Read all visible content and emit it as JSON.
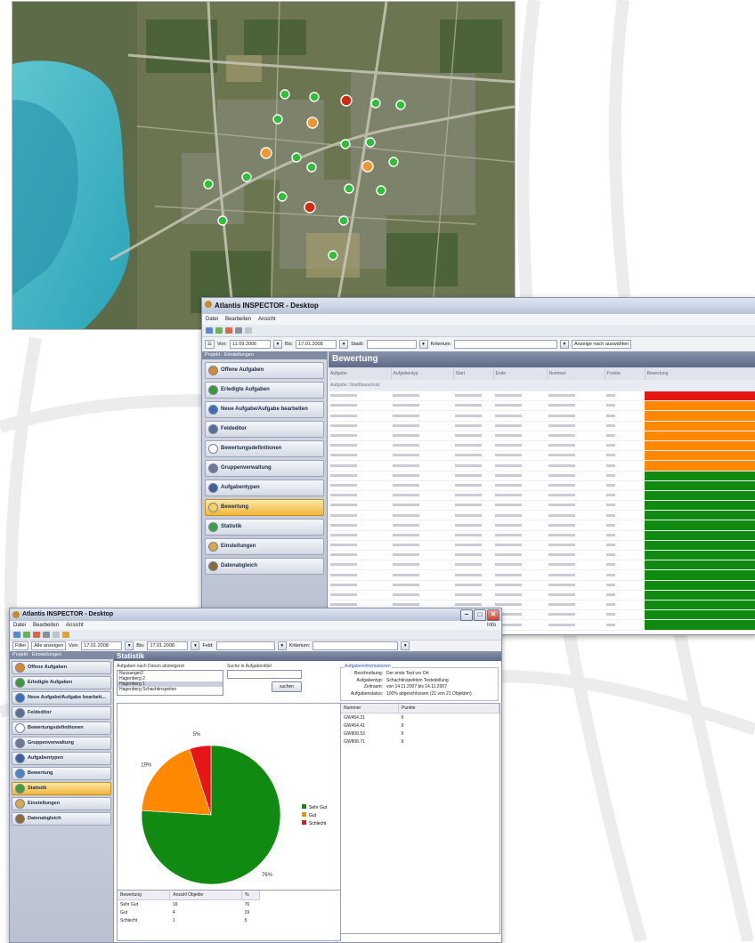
{
  "colors": {
    "sehr_gut": "#118a11",
    "gut": "#ff8800",
    "schlecht": "#e51616",
    "header_blue": "#6a7793",
    "active_item": "#f0b53c"
  },
  "map": {
    "markers_green": 20,
    "markers_orange": 4,
    "markers_red": 2
  },
  "mid_window": {
    "title": "Atlantis INSPECTOR - Desktop",
    "menu": [
      "Datei",
      "Bearbeiten",
      "Ansicht"
    ],
    "filter": {
      "von_label": "Von:",
      "von_value": "11.09.2006",
      "bis_label": "Bis:",
      "bis_value": "17.01.2008",
      "feld_label": "Stadt:",
      "kriterium_label": "Kriterium:",
      "anzeige_button": "Anzeige nach auswählen"
    },
    "sidebar_header": "Projekt · Einstellungen",
    "sidebar_items": [
      {
        "label": "Offene Aufgaben",
        "icon": "open-tasks-icon",
        "color": "#d6892a"
      },
      {
        "label": "Erledigte Aufgaben",
        "icon": "done-tasks-icon",
        "color": "#3a9a3a"
      },
      {
        "label": "Neue Aufgabe/Aufgabe bearbeiten",
        "icon": "new-task-icon",
        "color": "#3b6fb8"
      },
      {
        "label": "Feldeditor",
        "icon": "field-editor-icon",
        "color": "#5a6f94"
      },
      {
        "label": "Bewertungsdefinitionen",
        "icon": "rating-definitions-icon",
        "color": "#ffffff"
      },
      {
        "label": "Gruppenverwaltung",
        "icon": "group-management-icon",
        "color": "#6e7a94"
      },
      {
        "label": "Aufgabentypen",
        "icon": "task-types-icon",
        "color": "#3f5f99"
      },
      {
        "label": "Bewertung",
        "icon": "rating-icon",
        "color": "#f6d060"
      },
      {
        "label": "Statistik",
        "icon": "statistics-icon",
        "color": "#3aa040"
      },
      {
        "label": "Einstellungen",
        "icon": "settings-icon",
        "color": "#d9a84a"
      },
      {
        "label": "Datenabgleich",
        "icon": "sync-icon",
        "color": "#8a6c3a"
      }
    ],
    "active_index": 7,
    "content_title": "Bewertung",
    "columns": [
      "Aufgabe",
      "Aufgabentyp",
      "Start",
      "Ende",
      "Nummer",
      "Punkte",
      "Bewertung"
    ],
    "group_label": "Aufgabe: Stadtbauschutz"
  },
  "bottom_window": {
    "title": "Atlantis INSPECTOR - Desktop",
    "menu": [
      "Datei",
      "Bearbeiten",
      "Ansicht"
    ],
    "info_menu": "Info",
    "filter": {
      "filter_btn": "Filter",
      "alle_btn": "Alle anzeigen",
      "von_label": "Von:",
      "von_value": "17.01.2008",
      "bis_label": "Bis:",
      "bis_value": "17.01.2008",
      "feld_label": "Feld:",
      "kriterium_label": "Kriterium:"
    },
    "sidebar_header": "Projekt · Einstellungen",
    "sidebar_items": [
      {
        "label": "Offene Aufgaben",
        "icon": "open-tasks-icon",
        "color": "#d6892a"
      },
      {
        "label": "Erledigte Aufgaben",
        "icon": "done-tasks-icon",
        "color": "#3a9a3a"
      },
      {
        "label": "Neue Aufgabe/Aufgabe bearbeit...",
        "icon": "new-task-icon",
        "color": "#3b6fb8"
      },
      {
        "label": "Feldeditor",
        "icon": "field-editor-icon",
        "color": "#5a6f94"
      },
      {
        "label": "Bewertungsdefinitionen",
        "icon": "rating-definitions-icon",
        "color": "#ffffff"
      },
      {
        "label": "Gruppenverwaltung",
        "icon": "group-management-icon",
        "color": "#6e7a94"
      },
      {
        "label": "Aufgabentypen",
        "icon": "task-types-icon",
        "color": "#3f5f99"
      },
      {
        "label": "Bewertung",
        "icon": "rating-icon",
        "color": "#4b86c8"
      },
      {
        "label": "Statistik",
        "icon": "statistics-icon",
        "color": "#3aa040"
      },
      {
        "label": "Einstellungen",
        "icon": "settings-icon",
        "color": "#d9a84a"
      },
      {
        "label": "Datenabgleich",
        "icon": "sync-icon",
        "color": "#8a6c3a"
      }
    ],
    "active_index": 8,
    "content_title": "Statistik",
    "task_list_label": "Aufgaben nach Datum absteigend",
    "tasks": [
      "Nussanger2",
      "Hagenberg 2",
      "Hagenberg 1",
      "Hagenberg Schachtinspetion"
    ],
    "selected_task": 2,
    "search_label": "Suche in Aufgabentitel",
    "search_button": "suchen",
    "info": {
      "title": "Aufgabeninformationen",
      "rows": [
        {
          "label": "Beschreibung:",
          "value": "Der erste Test vor Ort"
        },
        {
          "label": "Aufgabentyp:",
          "value": "Schachtinspektion Testeitellung"
        },
        {
          "label": "Zeitraum:",
          "value": "von 14.11.2007 bis 14.11.2007"
        },
        {
          "label": "Aufgabenstatus:",
          "value": "100% abgeschlossen (21 von 21 Objekten)"
        }
      ]
    },
    "object_table": {
      "columns": [
        "Nummer",
        "Punkte"
      ],
      "rows": [
        [
          "GW454.21",
          "9"
        ],
        [
          "GW454.41",
          "9"
        ],
        [
          "GW808.53",
          "9"
        ],
        [
          "GW808.71",
          "9"
        ]
      ]
    },
    "summary_table": {
      "columns": [
        "Bewertung",
        "Anzahl Objekte",
        "%"
      ],
      "rows": [
        [
          "Sehr Gut",
          "16",
          "76"
        ],
        [
          "Gut",
          "4",
          "19"
        ],
        [
          "Schlecht",
          "1",
          "5"
        ]
      ]
    }
  },
  "chart_data": {
    "type": "pie",
    "categories": [
      "Sehr Gut",
      "Gut",
      "Schlecht"
    ],
    "values": [
      76,
      19,
      5
    ],
    "value_labels": [
      "76%",
      "19%",
      "5%"
    ],
    "legend": [
      "Sehr Gut",
      "Gut",
      "Schlecht"
    ],
    "legend_placement": "right",
    "colors": [
      "#118a11",
      "#ff8800",
      "#e51616"
    ]
  }
}
